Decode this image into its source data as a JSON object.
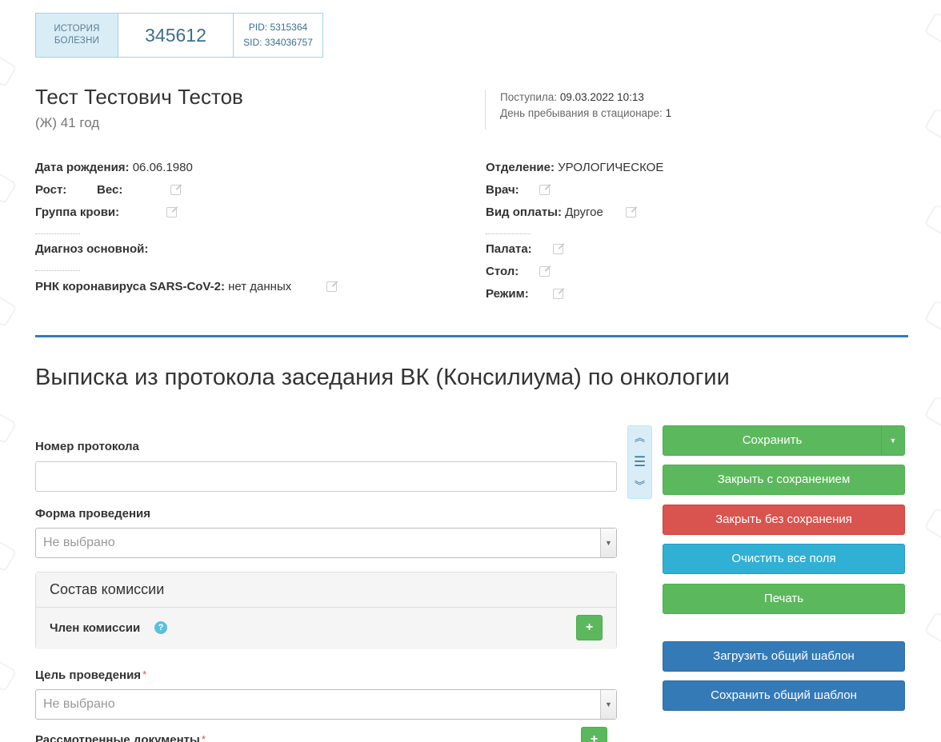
{
  "record": {
    "label_line1": "ИСТОРИЯ",
    "label_line2": "БОЛЕЗНИ",
    "number": "345612",
    "pid": "PID: 5315364",
    "sid": "SID: 334036757"
  },
  "patient": {
    "name": "Тест Тестович Тестов",
    "sub": "(Ж) 41 год"
  },
  "admission": {
    "admitted_label": "Поступила:",
    "admitted_value": "09.03.2022 10:13",
    "stay_label": "День пребывания в стационаре:",
    "stay_value": "1"
  },
  "info_left": {
    "dob_label": "Дата рождения:",
    "dob_value": "06.06.1980",
    "height_label": "Рост:",
    "weight_label": "Вес:",
    "blood_label": "Группа крови:",
    "diag_label": "Диагноз основной:",
    "covid_label": "РНК коронавируса SARS-CoV-2:",
    "covid_value": "нет данных"
  },
  "info_right": {
    "dept_label": "Отделение:",
    "dept_value": "УРОЛОГИЧЕСКОЕ",
    "doctor_label": "Врач:",
    "payment_label": "Вид оплаты:",
    "payment_value": "Другое",
    "ward_label": "Палата:",
    "table_label": "Стол:",
    "regime_label": "Режим:"
  },
  "document": {
    "title": "Выписка из протокола заседания ВК (Консилиума) по онкологии"
  },
  "form": {
    "protocol_label": "Номер протокола",
    "protocol_value": "",
    "form_label": "Форма проведения",
    "form_value": "Не выбрано",
    "commission_title": "Состав комиссии",
    "member_label": "Член комиссии",
    "help": "?",
    "add": "+",
    "goal_label": "Цель проведения",
    "goal_required": "*",
    "goal_value": "Не выбрано",
    "docs_label": "Рассмотренные документы",
    "docs_required": "*"
  },
  "actions": {
    "save": "Сохранить",
    "close_save": "Закрыть с сохранением",
    "close_nosave": "Закрыть без сохранения",
    "clear": "Очистить все поля",
    "print": "Печать",
    "load_template": "Загрузить общий шаблон",
    "save_template": "Сохранить общий шаблон"
  },
  "icons": {
    "scroll_up": "chevrons-up-icon",
    "menu": "menu-icon",
    "scroll_down": "chevrons-down-icon",
    "edit": "edit-icon",
    "caret": "caret-down-icon"
  },
  "colors": {
    "primary": "#337ab7",
    "success": "#5cb85c",
    "danger": "#d9534f",
    "info": "#31b0d5"
  }
}
